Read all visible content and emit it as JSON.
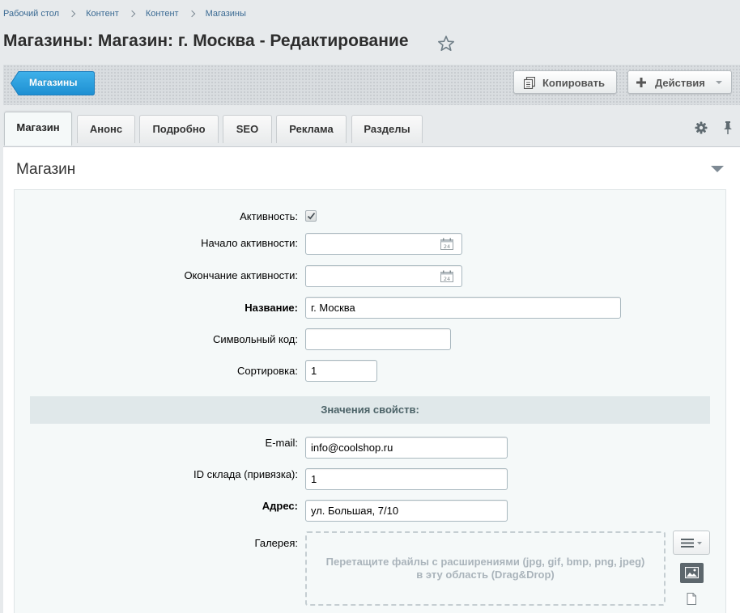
{
  "breadcrumb": [
    "Рабочий стол",
    "Контент",
    "Контент",
    "Магазины"
  ],
  "page_title": "Магазины: Магазин: г. Москва - Редактирование",
  "toolbar": {
    "back_label": "Магазины",
    "copy_label": "Копировать",
    "actions_label": "Действия"
  },
  "tabs": [
    "Магазин",
    "Анонс",
    "Подробно",
    "SEO",
    "Реклама",
    "Разделы"
  ],
  "section_title": "Магазин",
  "form": {
    "active_label": "Активность:",
    "active_checked": true,
    "start_label": "Начало активности:",
    "start_value": "",
    "end_label": "Окончание активности:",
    "end_value": "",
    "name_label": "Название:",
    "name_value": "г. Москва",
    "code_label": "Символьный код:",
    "code_value": "",
    "sort_label": "Сортировка:",
    "sort_value": "1"
  },
  "properties": {
    "header": "Значения свойств:",
    "email_label": "E-mail:",
    "email_value": "info@coolshop.ru",
    "warehouse_label": "ID склада (привязка):",
    "warehouse_value": "1",
    "address_label": "Адрес:",
    "address_value": "ул. Большая, 7/10",
    "gallery_label": "Галерея:",
    "dropzone_text": "Перетащите файлы с расширениями (jpg, gif, bmp, png, jpeg) в эту область (Drag&Drop)"
  },
  "colors": {
    "accent": "#1d8fd2",
    "background": "#e7eaec",
    "form_background": "#f5f9f9"
  }
}
